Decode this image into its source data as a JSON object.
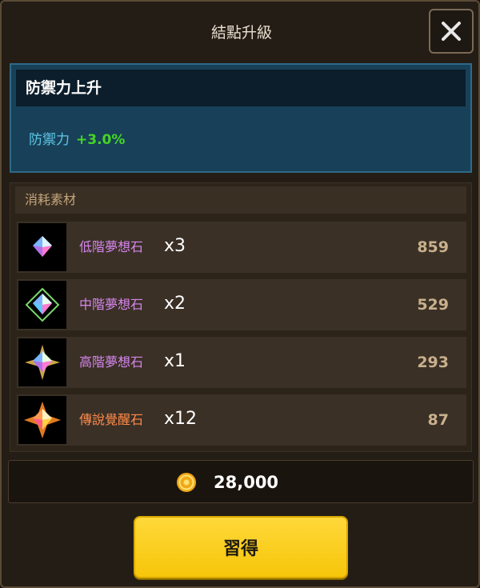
{
  "dialog": {
    "title": "結點升級"
  },
  "effect": {
    "header": "防禦力上升",
    "stat_name": "防禦力",
    "stat_value": "+3.0%"
  },
  "materials": {
    "header": "消耗素材",
    "items": [
      {
        "name": "低階夢想石",
        "qty": "x3",
        "owned": "859",
        "icon": "low-dream-stone-icon"
      },
      {
        "name": "中階夢想石",
        "qty": "x2",
        "owned": "529",
        "icon": "mid-dream-stone-icon"
      },
      {
        "name": "高階夢想石",
        "qty": "x1",
        "owned": "293",
        "icon": "high-dream-stone-icon"
      },
      {
        "name": "傳說覺醒石",
        "qty": "x12",
        "owned": "87",
        "icon": "legend-awakening-stone-icon"
      }
    ]
  },
  "cost": {
    "value": "28,000",
    "icon": "gold-coin-icon"
  },
  "actions": {
    "learn_label": "習得"
  },
  "colors": {
    "accent_button": "#f6c60a",
    "stat_value": "#46d624",
    "stat_name": "#5ec8e8",
    "material_name": "#d686ee",
    "legend_material_name": "#ff8a4a"
  }
}
